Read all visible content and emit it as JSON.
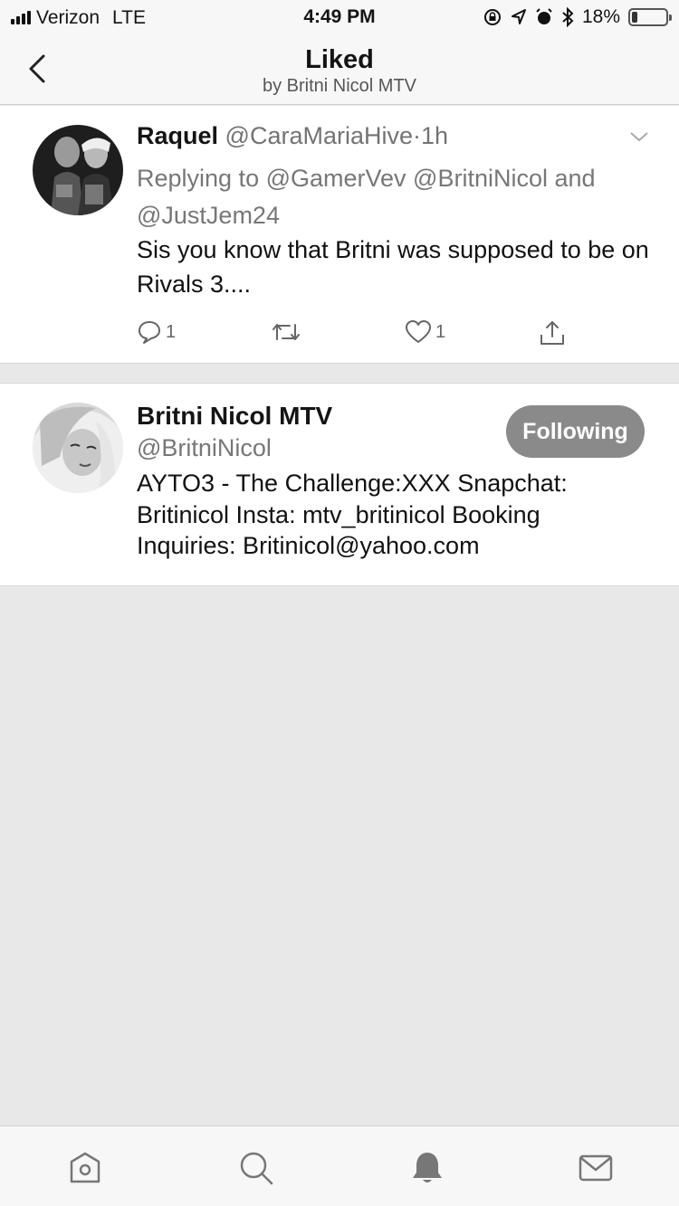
{
  "status_bar": {
    "carrier": "Verizon",
    "network": "LTE",
    "time": "4:49 PM",
    "battery_percent": "18%",
    "battery_level": 0.18
  },
  "nav": {
    "title": "Liked",
    "subtitle": "by Britni Nicol MTV"
  },
  "tweet": {
    "name": "Raquel",
    "handle": "@CaraMariaHive",
    "separator": "·",
    "time": "1h",
    "replying_to": "Replying to @GamerVev @BritniNicol and @JustJem24",
    "text": "Sis you know that Britni was supposed to be on Rivals 3....",
    "reply_count": "1",
    "like_count": "1"
  },
  "profile": {
    "name": "Britni Nicol MTV",
    "handle": "@BritniNicol",
    "bio": "AYTO3 - The Challenge:XXX Snapchat: Britinicol Insta: mtv_britinicol Booking Inquiries: Britinicol@yahoo.com",
    "follow_label": "Following"
  },
  "tab_bar": {
    "icons": [
      "home-icon",
      "search-icon",
      "notifications-icon",
      "messages-icon"
    ]
  }
}
